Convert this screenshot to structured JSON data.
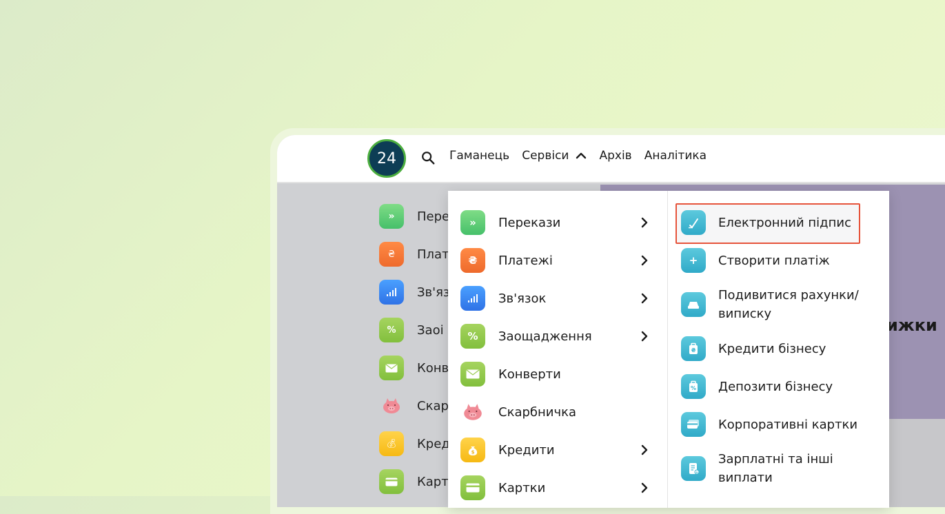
{
  "header": {
    "logo_text": "24",
    "nav": [
      "Гаманець",
      "Сервіси",
      "Архів",
      "Аналітика"
    ]
  },
  "background": {
    "menu_labels": [
      "Пере",
      "Плат",
      "Зв'яз",
      "Заоі",
      "Конв",
      "Скар",
      "Кред",
      "Карт"
    ],
    "heading_fragment": "ижки"
  },
  "dropdown": {
    "main_items": [
      {
        "label": "Перекази",
        "icon": "transfer-icon",
        "has_submenu": true
      },
      {
        "label": "Платежі",
        "icon": "payment-icon",
        "has_submenu": true
      },
      {
        "label": "Зв'язок",
        "icon": "signal-icon",
        "has_submenu": true
      },
      {
        "label": "Заощадження",
        "icon": "percent-icon",
        "has_submenu": true
      },
      {
        "label": "Конверти",
        "icon": "envelope-icon",
        "has_submenu": false
      },
      {
        "label": "Скарбничка",
        "icon": "piggy-bank-icon",
        "has_submenu": false
      },
      {
        "label": "Кредити",
        "icon": "money-bag-icon",
        "has_submenu": true
      },
      {
        "label": "Картки",
        "icon": "card-icon",
        "has_submenu": true
      }
    ],
    "sub_items": [
      {
        "label": "Електронний підпис",
        "icon": "signature-icon",
        "highlighted": true
      },
      {
        "label": "Створити платіж",
        "icon": "plus-icon"
      },
      {
        "label": "Подивитися рахунки/ виписку",
        "icon": "statement-icon"
      },
      {
        "label": "Кредити бізнесу",
        "icon": "business-credit-icon"
      },
      {
        "label": "Депозити бізнесу",
        "icon": "business-deposit-icon"
      },
      {
        "label": "Корпоративні картки",
        "icon": "corporate-card-icon"
      },
      {
        "label": "Зарплатні та інші виплати",
        "icon": "salary-icon"
      }
    ]
  },
  "colors": {
    "highlight_border": "#e6533a",
    "logo_bg": "#0d3d55",
    "logo_ring": "#4cae3f",
    "sub_icon": "#3bb4cf"
  }
}
